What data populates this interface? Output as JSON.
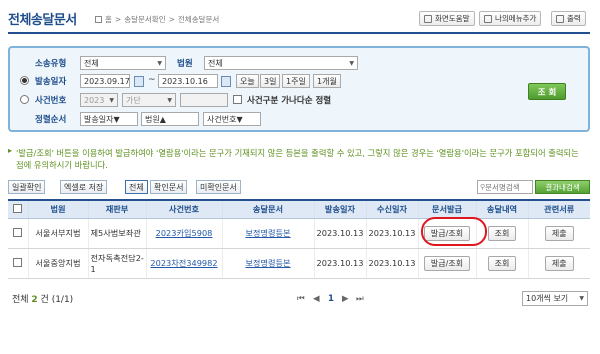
{
  "header": {
    "title": "전체송달문서",
    "breadcrumb": [
      "홈",
      ">",
      "송달문서확인",
      ">",
      "전체송달문서"
    ],
    "buttons": [
      {
        "label": "화면도움말",
        "icon": "help-icon"
      },
      {
        "label": "나의메뉴추가",
        "icon": "bookmark-icon"
      },
      {
        "label": "출력",
        "icon": "printer-icon"
      }
    ]
  },
  "search": {
    "type_label": "소송유형",
    "type_value": "전체",
    "court_label": "법원",
    "court_value": "전체",
    "date_label": "발송일자",
    "date_from": "2023.09.17",
    "date_tilde": "~",
    "date_to": "2023.10.16",
    "quick_ranges": [
      "오늘",
      "3일",
      "1주일",
      "1개월"
    ],
    "case_label": "사건번호",
    "case_year": "2023",
    "case_type": "가단",
    "case_sort_check_label": "사건구분 가나다순 정렬",
    "order_label": "정렬순서",
    "order_values": [
      "발송일자▼",
      "법원▲",
      "사건번호▼"
    ],
    "search_button": "조 회"
  },
  "notice": "'발급/조회' 버튼을 이용하여 발급하여야 '열람용'이라는 문구가 기재되지 않은 등본을 출력할 수 있고, 그렇지 않은 경우는 '열람용'이라는 문구가 포함되어 출력되는 점에 유의하시기 바랍니다.",
  "toolbar": {
    "buttons": [
      "일괄확인",
      "엑셀로 저장",
      "전체",
      "확인문서",
      "미확인문서"
    ],
    "filter_placeholder": "문서명검색",
    "filter_button": "결과내검색"
  },
  "table": {
    "headers": [
      "",
      "법원",
      "재판부",
      "사건번호",
      "송달문서",
      "발송일자",
      "수신일자",
      "문서발급",
      "송달내역",
      "관련서류"
    ],
    "rows": [
      {
        "court": "서울서부지법",
        "division": "제5사법보좌관",
        "case_no": "2023카입5908",
        "document": "보정명령등본",
        "sent": "2023.10.13",
        "received": "2023.10.13",
        "issue": "발급/조회",
        "history": "조회",
        "related": "제출"
      },
      {
        "court": "서울중앙지법",
        "division": "전자독촉전담2-1",
        "case_no": "2023차전349982",
        "document": "보정명령등본",
        "sent": "2023.10.13",
        "received": "2023.10.13",
        "issue": "발급/조회",
        "history": "조회",
        "related": "제출"
      }
    ]
  },
  "footer": {
    "total_prefix": "전체 ",
    "total_count": "2",
    "total_suffix": " 건 (1/1)",
    "page": "1",
    "nav_first": "⏮",
    "nav_prev": "◀",
    "nav_next": "▶",
    "nav_last": "⏭",
    "page_size": "10개씩 보기"
  },
  "colors": {
    "brand": "#1f4e8c",
    "highlight": "#e0161f",
    "search_green": "#4e9a2c"
  }
}
